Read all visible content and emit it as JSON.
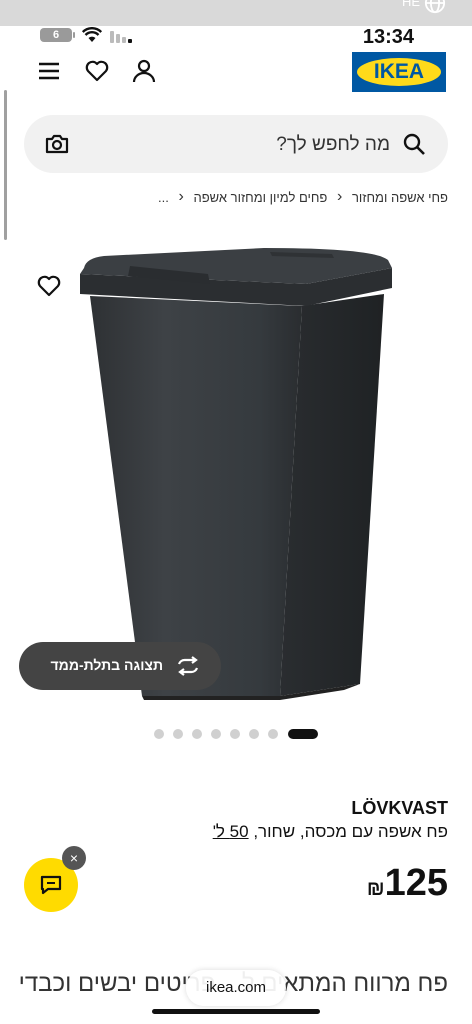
{
  "system": {
    "top_lang": "HE",
    "battery": "6",
    "time": "13:34"
  },
  "header": {
    "logo_text": "IKEA",
    "icons": [
      "menu-icon",
      "heart-icon",
      "account-icon"
    ]
  },
  "search": {
    "placeholder": "מה לחפש לך?"
  },
  "breadcrumb": {
    "items": [
      "פחי אשפה ומחזור",
      "פחים למיון ומחזור אשפה",
      "..."
    ]
  },
  "gallery": {
    "view_3d_label": "תצוגה בתלת-ממד",
    "total_images": 8,
    "active_index": 0
  },
  "product": {
    "brand": "LÖVKVAST",
    "description": "פח אשפה עם מכסה, שחור,",
    "size": "50 ל'",
    "price": "125",
    "currency": "₪",
    "long_text": "פח מרווח המתאים ל... פריטים יבשים וכבדים במקום אחד, בנוסף המתכוון"
  },
  "browser": {
    "url": "ikea.com"
  },
  "colors": {
    "ikea_blue": "#0058a3",
    "ikea_yellow": "#ffda1a",
    "chat_yellow": "#ffdb00"
  }
}
